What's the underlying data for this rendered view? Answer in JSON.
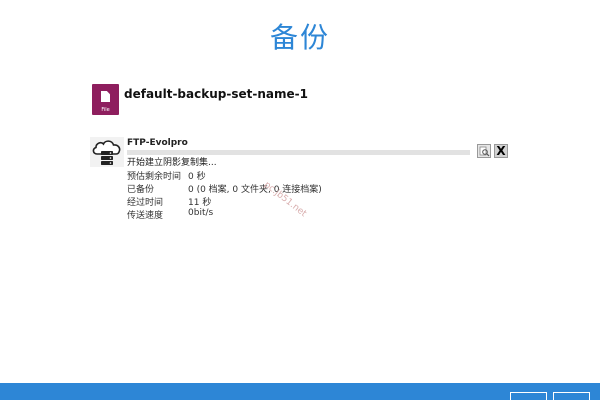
{
  "page": {
    "title": "备份"
  },
  "backup_set": {
    "icon": "file-icon",
    "icon_label": "File",
    "name": "default-backup-set-name-1"
  },
  "destination": {
    "icon": "cloud-server-icon",
    "name": "FTP-Evolpro",
    "progress": 0,
    "status": "开始建立阴影复制集...",
    "log_icon": "magnify-log-icon",
    "close_label": "X"
  },
  "info": [
    {
      "label": "预估剩余时间",
      "value": "0 秒"
    },
    {
      "label": "已备份",
      "value": "0 (0 档案, 0 文件夹, 0 连接档案)"
    },
    {
      "label": "经过时间",
      "value": "11 秒"
    },
    {
      "label": "传送速度",
      "value": "0bit/s"
    }
  ],
  "watermark": "pc.jb51.net",
  "colors": {
    "accent": "#2d86d6",
    "backup_set_icon": "#8e1e5e",
    "progress_track": "#e2e2e2"
  }
}
